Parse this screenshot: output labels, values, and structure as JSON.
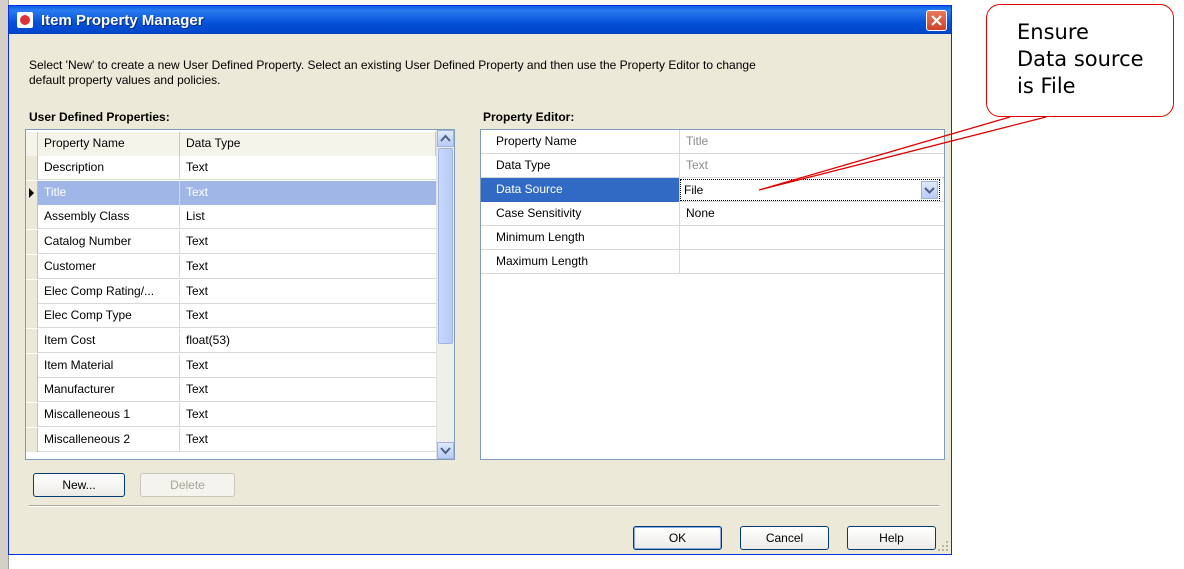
{
  "window": {
    "title": "Item Property Manager",
    "instructions_line1": "Select 'New' to create a new User Defined Property.  Select an existing User Defined Property and then use the Property Editor to change",
    "instructions_line2": "default property values and policies."
  },
  "left_panel": {
    "label": "User Defined Properties:",
    "columns": [
      "Property Name",
      "Data Type"
    ],
    "rows": [
      {
        "name": "Description",
        "type": "Text"
      },
      {
        "name": "Title",
        "type": "Text",
        "selected": true
      },
      {
        "name": "Assembly Class",
        "type": "List"
      },
      {
        "name": "Catalog Number",
        "type": "Text"
      },
      {
        "name": "Customer",
        "type": "Text"
      },
      {
        "name": "Elec Comp Rating/...",
        "type": "Text"
      },
      {
        "name": "Elec Comp Type",
        "type": "Text"
      },
      {
        "name": "Item Cost",
        "type": "float(53)"
      },
      {
        "name": "Item Material",
        "type": "Text"
      },
      {
        "name": "Manufacturer",
        "type": "Text"
      },
      {
        "name": "Miscalleneous 1",
        "type": "Text"
      },
      {
        "name": "Miscalleneous 2",
        "type": "Text"
      }
    ]
  },
  "right_panel": {
    "label": "Property Editor:",
    "rows": [
      {
        "label": "Property Name",
        "value": "Title"
      },
      {
        "label": "Data Type",
        "value": "Text"
      },
      {
        "label": "Data Source",
        "value": "File"
      },
      {
        "label": "Case Sensitivity",
        "value": "None"
      },
      {
        "label": "Minimum Length",
        "value": ""
      },
      {
        "label": "Maximum Length",
        "value": ""
      }
    ]
  },
  "buttons": {
    "new": "New...",
    "delete": "Delete",
    "ok": "OK",
    "cancel": "Cancel",
    "help": "Help"
  },
  "callout": {
    "line1": "Ensure",
    "line2": "Data source",
    "line3": "is File"
  },
  "colors": {
    "titlebar": "#0551d8",
    "selection": "#316ac5",
    "callout_border": "#e00000"
  }
}
